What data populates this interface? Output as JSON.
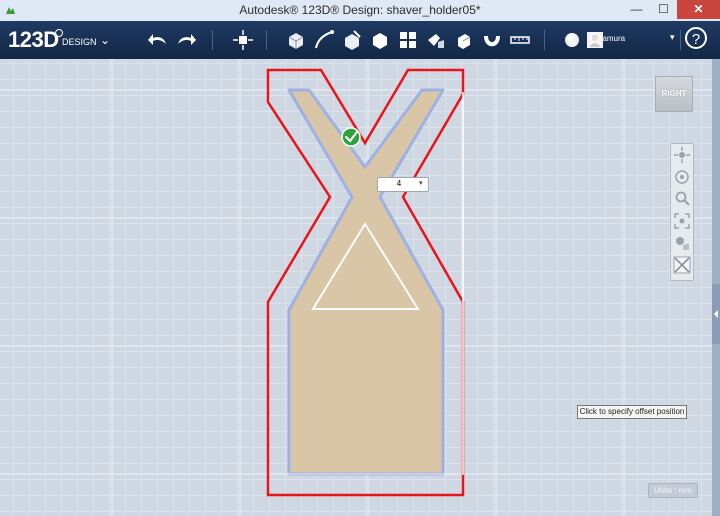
{
  "window": {
    "title": "Autodesk® 123D® Design: shaver_holder05*",
    "close_glyph": "✕",
    "minimize_glyph": "—",
    "maximize_glyph": "☐"
  },
  "toolbar": {
    "logo_main": "123D",
    "logo_sub": "DESIGN",
    "logo_menu_glyph": "⌄",
    "tools": [
      "undo-icon",
      "redo-icon",
      "transform-icon",
      "primitives-icon",
      "sketch-icon",
      "construct-icon",
      "modify-icon",
      "pattern-icon",
      "grouping-icon",
      "combine-icon",
      "snap-icon",
      "measure-icon",
      "material-icon",
      "text-icon"
    ],
    "user_name": "yimamura",
    "user_menu_glyph": "▾",
    "help_glyph": "?"
  },
  "viewport": {
    "viewcube_label": "RIGHT",
    "offset_value": "4",
    "offset_arrow": "▾",
    "tooltip": "Click to specify offset position",
    "units_label": "Units : mm",
    "colors": {
      "outline": "#e8141a",
      "shape_fill": "#d8c6a7",
      "shape_edge": "#9fb0e3",
      "confirm": "#2aa53a"
    }
  }
}
